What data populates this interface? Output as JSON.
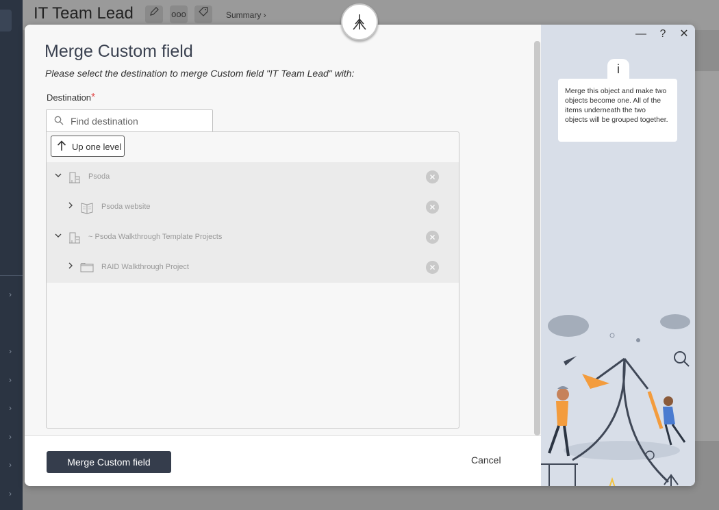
{
  "app": {
    "title": "IT Team Lead",
    "header_more": "ooo",
    "breadcrumb": "Summary ›"
  },
  "modal": {
    "title": "Merge Custom field",
    "subtitle": "Please select the destination to merge Custom field \"IT Team Lead\" with:",
    "destination_label": "Destination",
    "required_mark": "*",
    "search_placeholder": "Find destination",
    "up_button": "Up one level",
    "tree": [
      {
        "label": "Psoda",
        "expanded": true,
        "icon": "building-icon"
      },
      {
        "label": "Psoda website",
        "expanded": false,
        "icon": "book-icon"
      },
      {
        "label": "~ Psoda Walkthrough Template Projects",
        "expanded": true,
        "icon": "building-icon"
      },
      {
        "label": "RAID Walkthrough Project",
        "expanded": false,
        "icon": "folder-icon"
      }
    ],
    "merge_button": "Merge Custom field",
    "cancel_button": "Cancel"
  },
  "side": {
    "minimize": "—",
    "help": "?",
    "close": "✕",
    "info_icon": "i",
    "info_text": "Merge this object and make two objects become one. All of the items underneath the two objects will be grouped together."
  },
  "colors": {
    "primary_button": "#353d4c",
    "side_panel": "#d8dee8",
    "accent_orange": "#f39c3d",
    "required_red": "#e24b4b"
  }
}
